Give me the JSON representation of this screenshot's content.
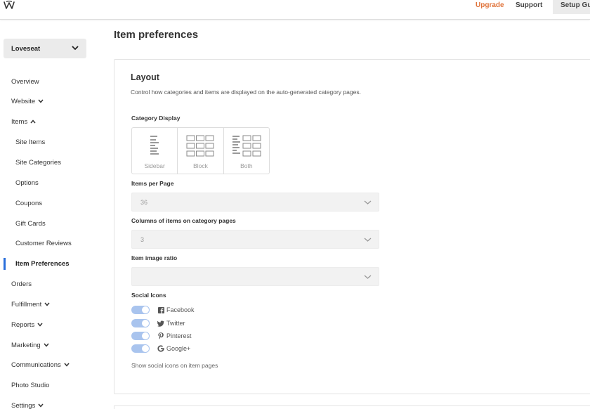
{
  "topbar": {
    "logo_icon": "weebly-w-icon",
    "upgrade": "Upgrade",
    "support": "Support",
    "setup": "Setup Gu",
    "accent_color": "#e0733a"
  },
  "sidebar": {
    "site_name": "Loveseat",
    "items": [
      {
        "label": "Overview"
      },
      {
        "label": "Website"
      },
      {
        "label": "Items"
      },
      {
        "label": "Site Items"
      },
      {
        "label": "Site Categories"
      },
      {
        "label": "Options"
      },
      {
        "label": "Coupons"
      },
      {
        "label": "Gift Cards"
      },
      {
        "label": "Customer Reviews"
      },
      {
        "label": "Item Preferences"
      },
      {
        "label": "Orders"
      },
      {
        "label": "Fulfillment"
      },
      {
        "label": "Reports"
      },
      {
        "label": "Marketing"
      },
      {
        "label": "Communications"
      },
      {
        "label": "Photo Studio"
      },
      {
        "label": "Settings"
      }
    ],
    "active_item": "Item Preferences",
    "active_color": "#2a6fdb"
  },
  "main": {
    "page_title": "Item preferences",
    "layout": {
      "title": "Layout",
      "description": "Control how categories and items are displayed on the auto-generated category pages.",
      "category_display": {
        "label": "Category Display",
        "options": [
          "Sidebar",
          "Block",
          "Both"
        ]
      },
      "items_per_page": {
        "label": "Items per Page",
        "value": "36"
      },
      "columns": {
        "label": "Columns of items on category pages",
        "value": "3"
      },
      "image_ratio": {
        "label": "Item image ratio",
        "value": ""
      },
      "social_icons": {
        "label": "Social Icons",
        "items": [
          {
            "label": "Facebook",
            "icon": "facebook-icon",
            "enabled": true
          },
          {
            "label": "Twitter",
            "icon": "twitter-icon",
            "enabled": true
          },
          {
            "label": "Pinterest",
            "icon": "pinterest-icon",
            "enabled": true
          },
          {
            "label": "Google+",
            "icon": "google-icon",
            "enabled": true
          }
        ],
        "note": "Show social icons on item pages",
        "toggle_color": "#a9c4ee"
      }
    }
  }
}
